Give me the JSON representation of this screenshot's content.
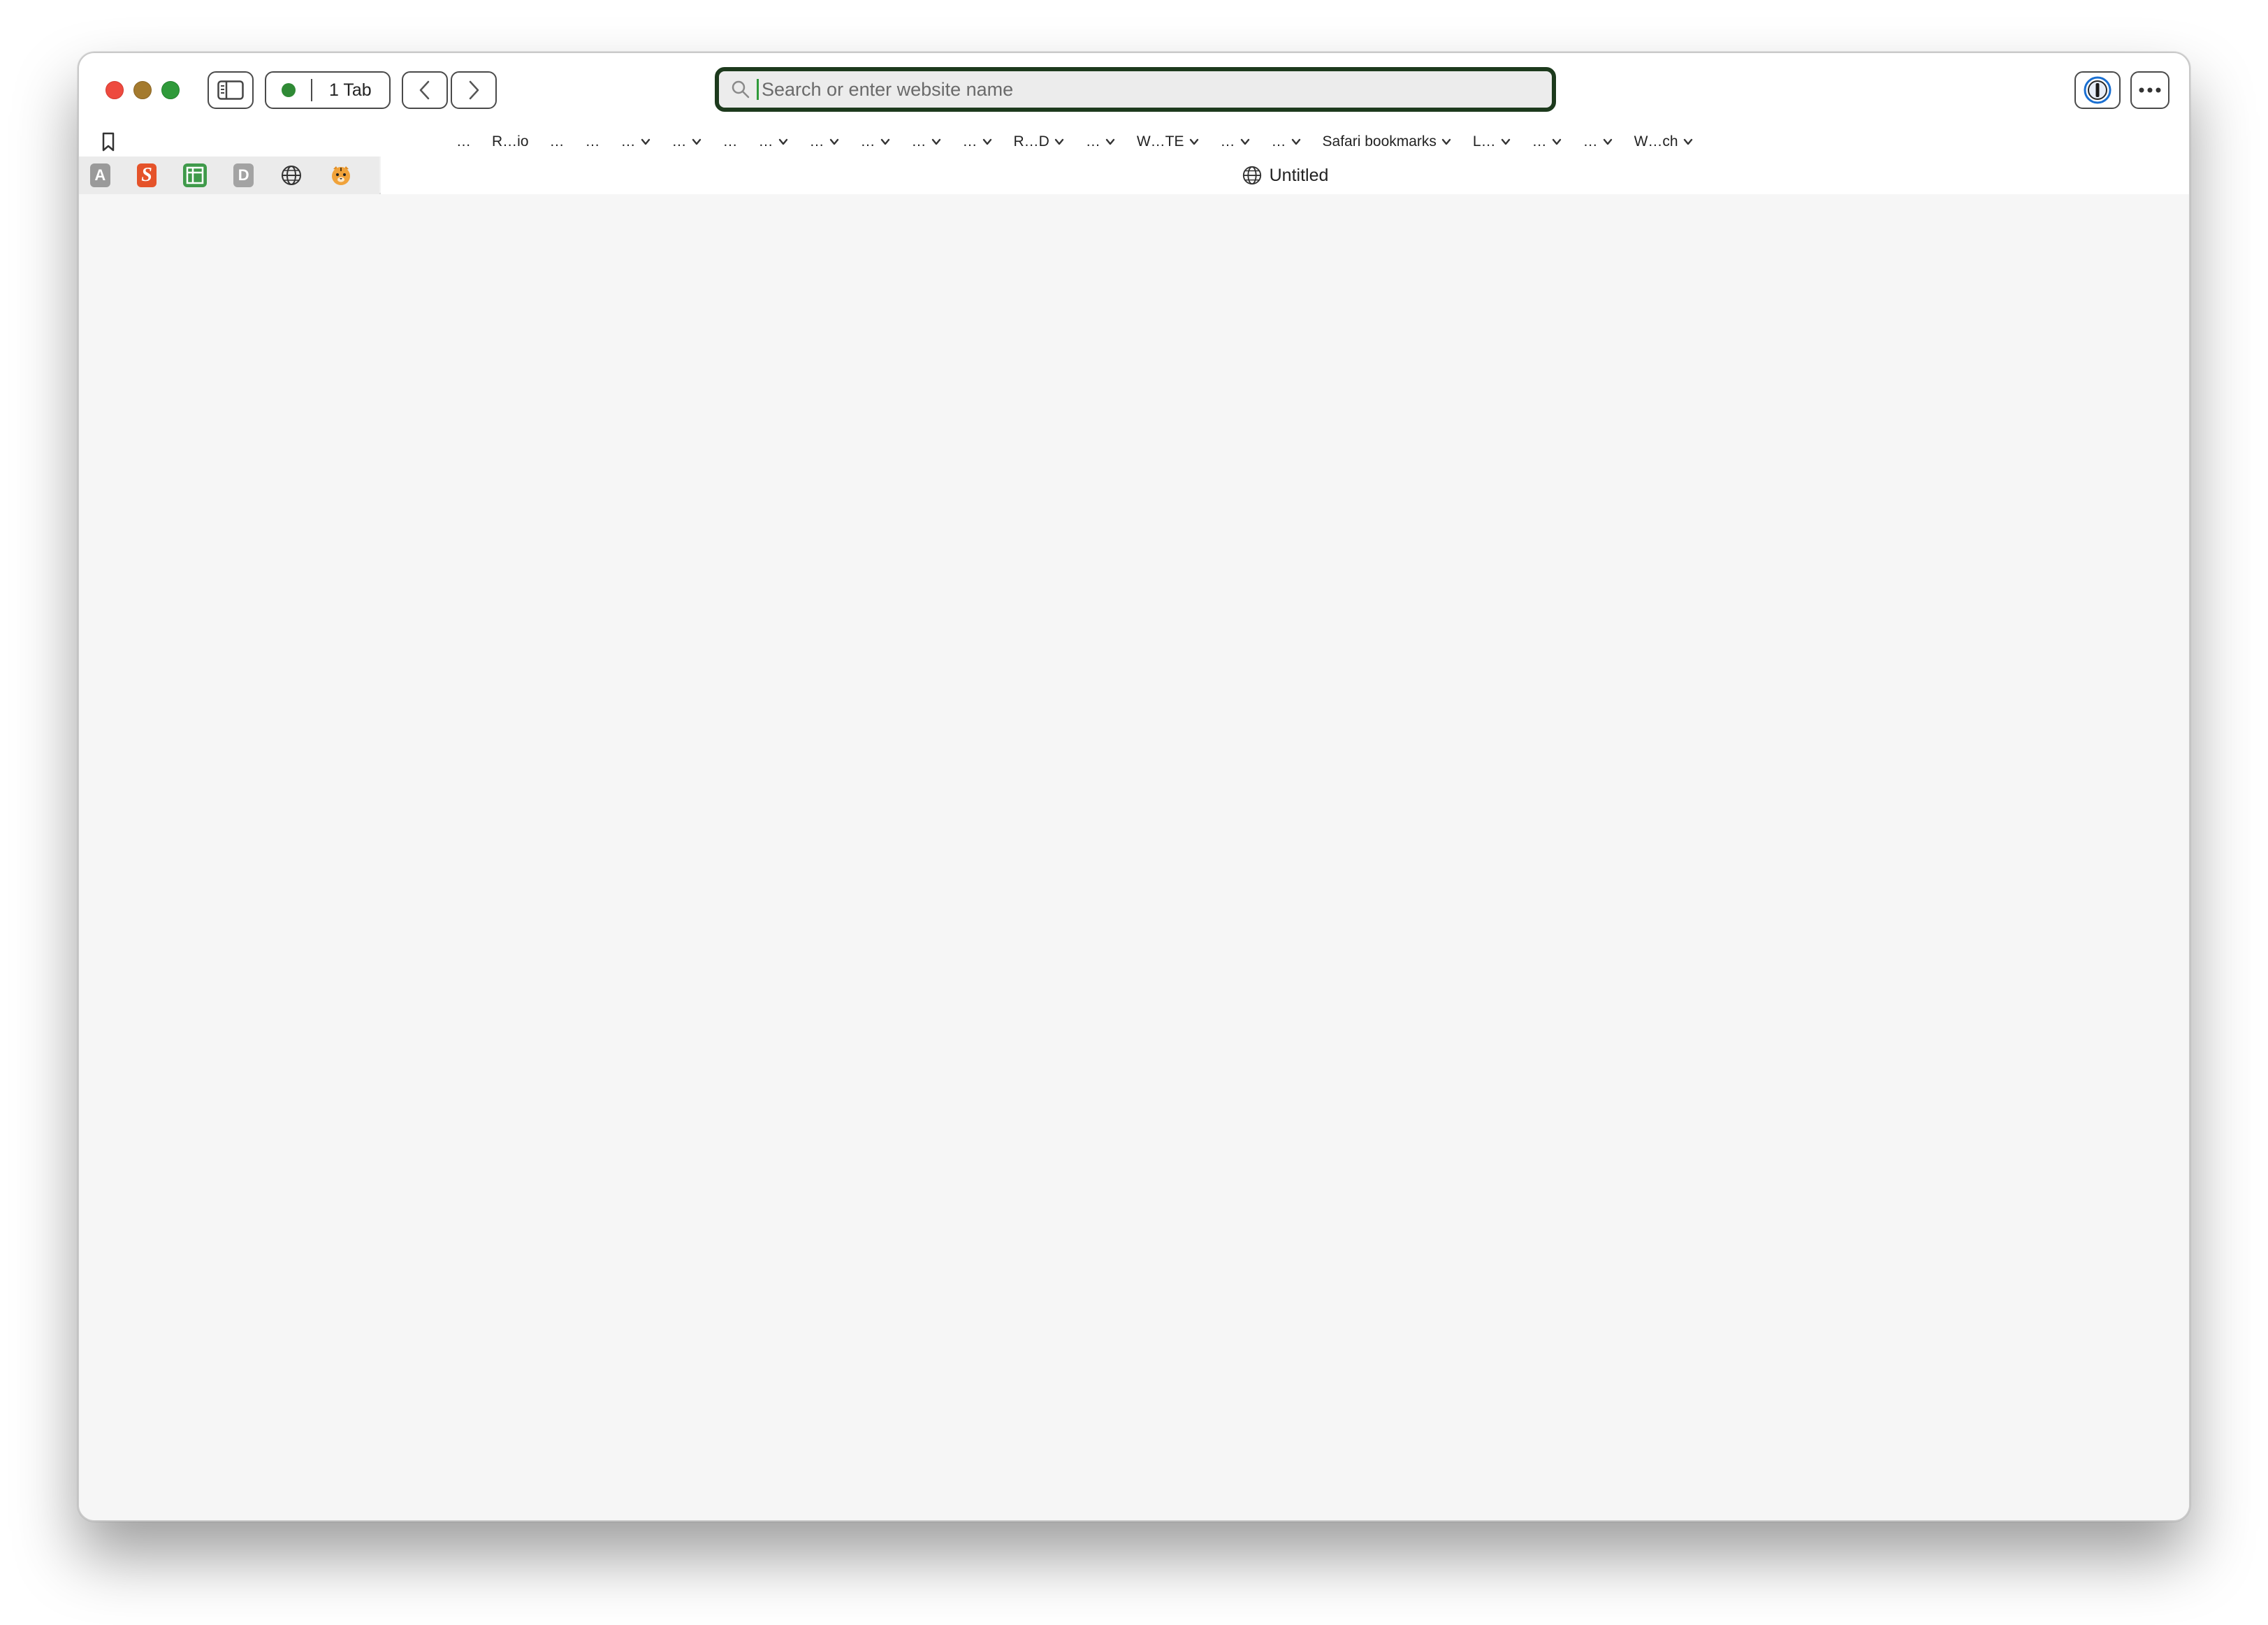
{
  "toolbar": {
    "tabs_label": "1 Tab",
    "address_placeholder": "Search or enter website name"
  },
  "favorites": [
    {
      "label": "…",
      "has_menu": false
    },
    {
      "label": "R…io",
      "has_menu": false
    },
    {
      "label": "…",
      "has_menu": false
    },
    {
      "label": "…",
      "has_menu": false
    },
    {
      "label": "…",
      "has_menu": true
    },
    {
      "label": "…",
      "has_menu": true
    },
    {
      "label": "…",
      "has_menu": false
    },
    {
      "label": "…",
      "has_menu": true
    },
    {
      "label": "…",
      "has_menu": true
    },
    {
      "label": "…",
      "has_menu": true
    },
    {
      "label": "…",
      "has_menu": true
    },
    {
      "label": "…",
      "has_menu": true
    },
    {
      "label": "R…D",
      "has_menu": true
    },
    {
      "label": "…",
      "has_menu": true
    },
    {
      "label": "W…TE",
      "has_menu": true
    },
    {
      "label": "…",
      "has_menu": true
    },
    {
      "label": "…",
      "has_menu": true
    },
    {
      "label": "Safari bookmarks",
      "has_menu": true
    },
    {
      "label": "L…",
      "has_menu": true
    },
    {
      "label": "…",
      "has_menu": true
    },
    {
      "label": "…",
      "has_menu": true
    },
    {
      "label": "W…ch",
      "has_menu": true
    }
  ],
  "pinned_tabs": [
    {
      "name": "pinned-tab-a",
      "glyph": "A"
    },
    {
      "name": "pinned-tab-s",
      "glyph": "S"
    },
    {
      "name": "pinned-tab-green",
      "glyph": ""
    },
    {
      "name": "pinned-tab-d",
      "glyph": "D"
    },
    {
      "name": "pinned-tab-web",
      "glyph": ""
    },
    {
      "name": "pinned-tab-tiger",
      "glyph": ""
    }
  ],
  "active_tab": {
    "title": "Untitled"
  },
  "colors": {
    "close": "#ee4a3f",
    "minimize": "#a47a2e",
    "maximize": "#2f9a3a",
    "address_focus_ring": "#1d3a1d"
  }
}
